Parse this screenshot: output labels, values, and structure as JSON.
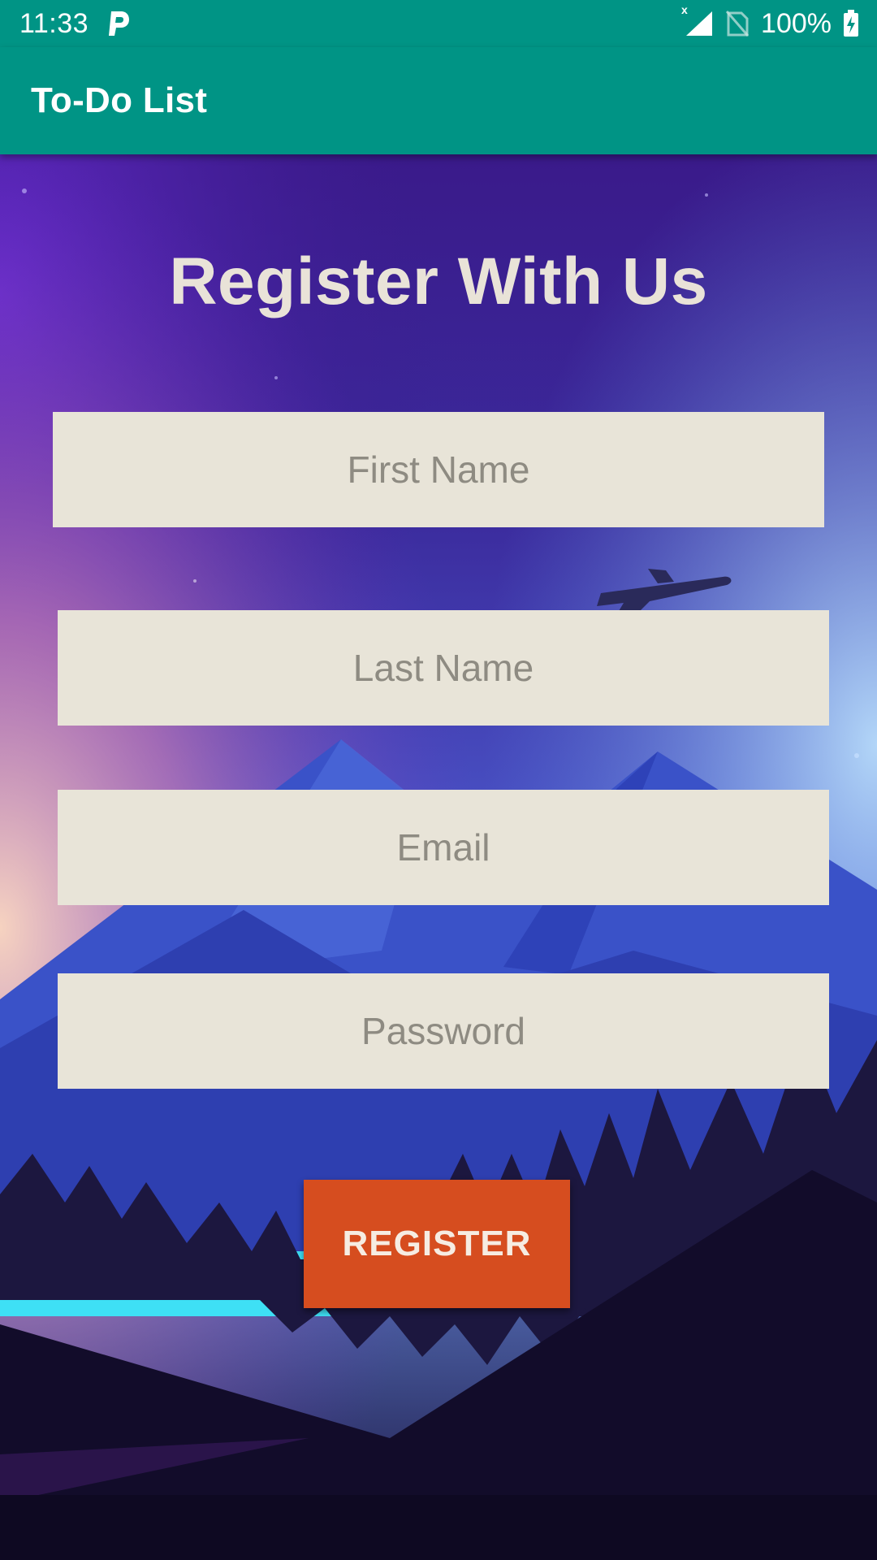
{
  "status_bar": {
    "time": "11:33",
    "notification_icon": "parking-p-icon",
    "signal_icon": "cell-signal-icon",
    "no_sim_icon": "no-sim-icon",
    "battery_percent": "100%",
    "battery_icon": "battery-charging-icon"
  },
  "app_bar": {
    "title": "To-Do List",
    "color": "#009485"
  },
  "form": {
    "heading": "Register With Us",
    "first_name": {
      "value": "",
      "placeholder": "First Name"
    },
    "last_name": {
      "value": "",
      "placeholder": "Last Name"
    },
    "email": {
      "value": "",
      "placeholder": "Email"
    },
    "password": {
      "value": "",
      "placeholder": "Password"
    },
    "register_label": "REGISTER",
    "button_color": "#d64d1f",
    "field_color": "#e8e4d8"
  },
  "background": {
    "description_icon": "mountain-landscape-image",
    "airplane_icon": "airplane-icon"
  }
}
